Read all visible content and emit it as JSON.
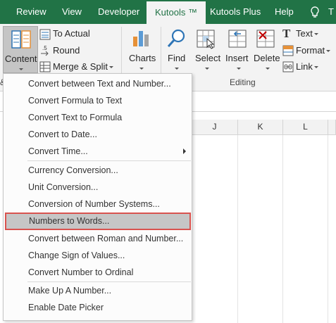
{
  "tabs": [
    "Review",
    "View",
    "Developer",
    "Kutools ™",
    "Kutools Plus",
    "Help",
    "T"
  ],
  "ribbon": {
    "content_label": "Content",
    "to_actual_label": "To Actual",
    "round_label": "Round",
    "merge_split_label": "Merge & Split",
    "charts_label": "Charts",
    "find_label": "Find",
    "select_label": "Select",
    "insert_label": "Insert",
    "delete_label": "Delete",
    "text_label": "Text",
    "format_label": "Format",
    "link_label": "Link",
    "editing_group_label": "Editing",
    "left_group_fragment": "&"
  },
  "columns": [
    "J",
    "K",
    "L"
  ],
  "menu": {
    "items": [
      "Convert between Text and Number...",
      "Convert Formula to Text",
      "Convert Text to Formula",
      "Convert to Date...",
      "Convert Time...",
      "Currency Conversion...",
      "Unit Conversion...",
      "Conversion of Number Systems...",
      "Numbers to Words...",
      "Convert between Roman and Number...",
      "Change Sign of Values...",
      "Convert Number to Ordinal",
      "Make Up A Number...",
      "Enable Date Picker"
    ],
    "highlighted_index": 8
  },
  "colors": {
    "tab_bar": "#217346",
    "highlight_border": "#d9534f",
    "highlight_fill": "#c6c6c6"
  }
}
